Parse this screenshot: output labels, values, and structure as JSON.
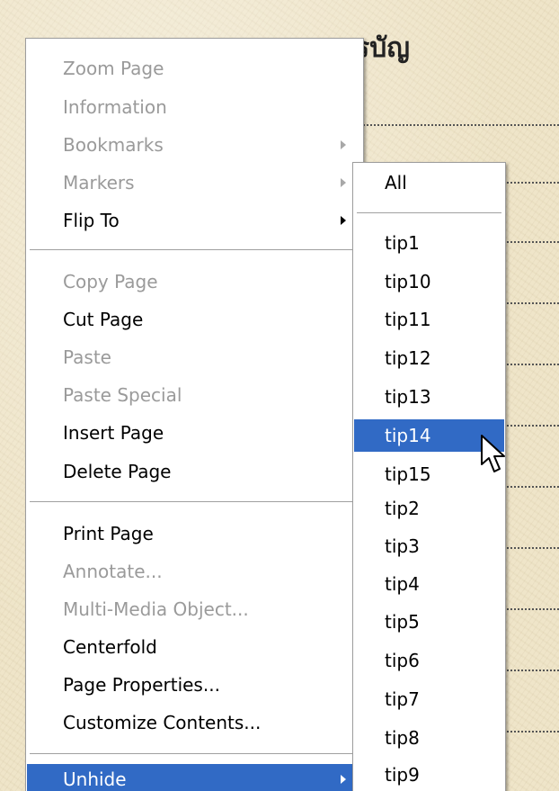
{
  "background_page": {
    "heading": "สารบัญ"
  },
  "context_menu": {
    "items": [
      {
        "label": "Zoom Page",
        "enabled": false
      },
      {
        "label": "Information",
        "enabled": false
      },
      {
        "label": "Bookmarks",
        "enabled": false,
        "submenu": true
      },
      {
        "label": "Markers",
        "enabled": false,
        "submenu": true
      },
      {
        "label": "Flip To",
        "enabled": true,
        "submenu": true
      },
      {
        "label": "Copy Page",
        "enabled": false
      },
      {
        "label": "Cut Page",
        "enabled": true
      },
      {
        "label": "Paste",
        "enabled": false
      },
      {
        "label": "Paste Special",
        "enabled": false
      },
      {
        "label": "Insert Page",
        "enabled": true
      },
      {
        "label": "Delete Page",
        "enabled": true
      },
      {
        "label": "Print Page",
        "enabled": true
      },
      {
        "label": "Annotate...",
        "enabled": false
      },
      {
        "label": "Multi-Media Object...",
        "enabled": false
      },
      {
        "label": "Centerfold",
        "enabled": true
      },
      {
        "label": "Page Properties...",
        "enabled": true
      },
      {
        "label": "Customize Contents...",
        "enabled": true
      },
      {
        "label": "Unhide",
        "enabled": true,
        "submenu": true,
        "highlighted": true
      }
    ]
  },
  "flip_to_submenu": {
    "all_label": "All",
    "items": [
      "tip1",
      "tip10",
      "tip11",
      "tip12",
      "tip13",
      "tip14",
      "tip15",
      "tip2",
      "tip3",
      "tip4",
      "tip5",
      "tip6",
      "tip7",
      "tip8",
      "tip9"
    ],
    "highlighted": "tip14"
  },
  "colors": {
    "highlight": "#316ac5",
    "disabled_text": "#9a9a9a",
    "page_background": "#efe5c9"
  }
}
